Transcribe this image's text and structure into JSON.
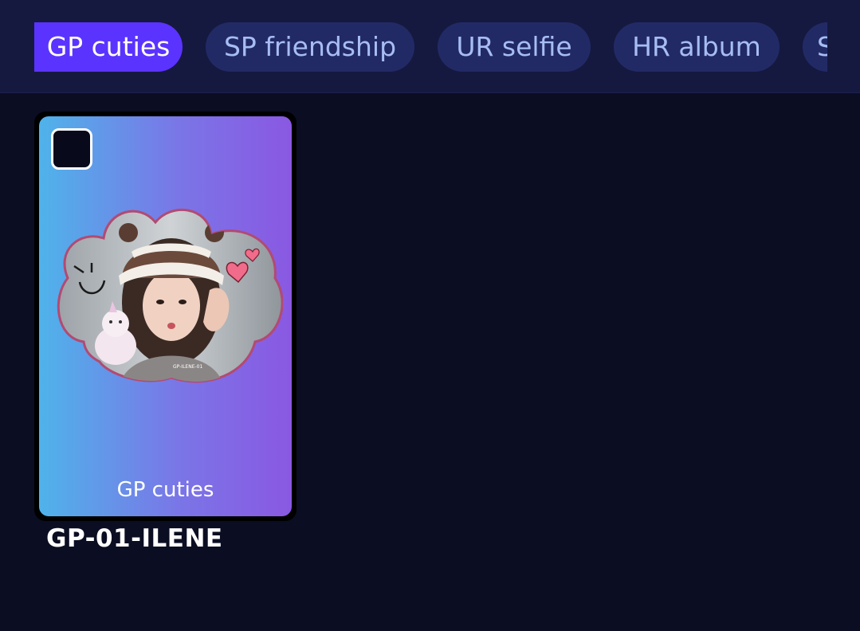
{
  "tabs": [
    {
      "label": "GP cuties",
      "active": true
    },
    {
      "label": "SP friendship",
      "active": false
    },
    {
      "label": "UR selfie",
      "active": false
    },
    {
      "label": "HR album",
      "active": false
    },
    {
      "label": "S",
      "active": false
    }
  ],
  "cards": [
    {
      "set_label": "GP cuties",
      "name": "GP-01-ILENE",
      "photo_watermark": "GP-ILENE-01",
      "checked": false
    }
  ],
  "colors": {
    "background": "#0b0d22",
    "topbar": "#15193f",
    "tab_active": "#5b33ff",
    "tab_inactive": "#222a66",
    "tab_inactive_text": "#a7bdf3",
    "card_gradient_start": "#4fb3ea",
    "card_gradient_end": "#8a58e2"
  }
}
